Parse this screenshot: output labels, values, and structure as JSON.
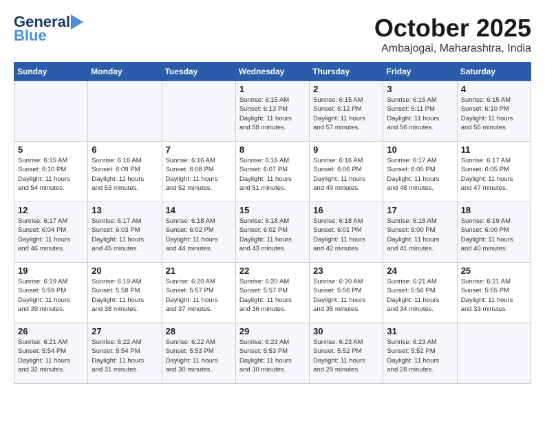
{
  "header": {
    "logo_general": "General",
    "logo_blue": "Blue",
    "month": "October 2025",
    "location": "Ambajogai, Maharashtra, India"
  },
  "days_of_week": [
    "Sunday",
    "Monday",
    "Tuesday",
    "Wednesday",
    "Thursday",
    "Friday",
    "Saturday"
  ],
  "weeks": [
    [
      {
        "day": "",
        "info": ""
      },
      {
        "day": "",
        "info": ""
      },
      {
        "day": "",
        "info": ""
      },
      {
        "day": "1",
        "info": "Sunrise: 6:15 AM\nSunset: 6:13 PM\nDaylight: 11 hours\nand 58 minutes."
      },
      {
        "day": "2",
        "info": "Sunrise: 6:15 AM\nSunset: 6:12 PM\nDaylight: 11 hours\nand 57 minutes."
      },
      {
        "day": "3",
        "info": "Sunrise: 6:15 AM\nSunset: 6:11 PM\nDaylight: 11 hours\nand 56 minutes."
      },
      {
        "day": "4",
        "info": "Sunrise: 6:15 AM\nSunset: 6:10 PM\nDaylight: 11 hours\nand 55 minutes."
      }
    ],
    [
      {
        "day": "5",
        "info": "Sunrise: 6:15 AM\nSunset: 6:10 PM\nDaylight: 11 hours\nand 54 minutes."
      },
      {
        "day": "6",
        "info": "Sunrise: 6:16 AM\nSunset: 6:09 PM\nDaylight: 11 hours\nand 53 minutes."
      },
      {
        "day": "7",
        "info": "Sunrise: 6:16 AM\nSunset: 6:08 PM\nDaylight: 11 hours\nand 52 minutes."
      },
      {
        "day": "8",
        "info": "Sunrise: 6:16 AM\nSunset: 6:07 PM\nDaylight: 11 hours\nand 51 minutes."
      },
      {
        "day": "9",
        "info": "Sunrise: 6:16 AM\nSunset: 6:06 PM\nDaylight: 11 hours\nand 49 minutes."
      },
      {
        "day": "10",
        "info": "Sunrise: 6:17 AM\nSunset: 6:05 PM\nDaylight: 11 hours\nand 48 minutes."
      },
      {
        "day": "11",
        "info": "Sunrise: 6:17 AM\nSunset: 6:05 PM\nDaylight: 11 hours\nand 47 minutes."
      }
    ],
    [
      {
        "day": "12",
        "info": "Sunrise: 6:17 AM\nSunset: 6:04 PM\nDaylight: 11 hours\nand 46 minutes."
      },
      {
        "day": "13",
        "info": "Sunrise: 6:17 AM\nSunset: 6:03 PM\nDaylight: 11 hours\nand 45 minutes."
      },
      {
        "day": "14",
        "info": "Sunrise: 6:18 AM\nSunset: 6:02 PM\nDaylight: 11 hours\nand 44 minutes."
      },
      {
        "day": "15",
        "info": "Sunrise: 6:18 AM\nSunset: 6:02 PM\nDaylight: 11 hours\nand 43 minutes."
      },
      {
        "day": "16",
        "info": "Sunrise: 6:18 AM\nSunset: 6:01 PM\nDaylight: 11 hours\nand 42 minutes."
      },
      {
        "day": "17",
        "info": "Sunrise: 6:18 AM\nSunset: 6:00 PM\nDaylight: 11 hours\nand 41 minutes."
      },
      {
        "day": "18",
        "info": "Sunrise: 6:19 AM\nSunset: 6:00 PM\nDaylight: 11 hours\nand 40 minutes."
      }
    ],
    [
      {
        "day": "19",
        "info": "Sunrise: 6:19 AM\nSunset: 5:59 PM\nDaylight: 11 hours\nand 39 minutes."
      },
      {
        "day": "20",
        "info": "Sunrise: 6:19 AM\nSunset: 5:58 PM\nDaylight: 11 hours\nand 38 minutes."
      },
      {
        "day": "21",
        "info": "Sunrise: 6:20 AM\nSunset: 5:57 PM\nDaylight: 11 hours\nand 37 minutes."
      },
      {
        "day": "22",
        "info": "Sunrise: 6:20 AM\nSunset: 5:57 PM\nDaylight: 11 hours\nand 36 minutes."
      },
      {
        "day": "23",
        "info": "Sunrise: 6:20 AM\nSunset: 5:56 PM\nDaylight: 11 hours\nand 35 minutes."
      },
      {
        "day": "24",
        "info": "Sunrise: 6:21 AM\nSunset: 5:56 PM\nDaylight: 11 hours\nand 34 minutes."
      },
      {
        "day": "25",
        "info": "Sunrise: 6:21 AM\nSunset: 5:55 PM\nDaylight: 11 hours\nand 33 minutes."
      }
    ],
    [
      {
        "day": "26",
        "info": "Sunrise: 6:21 AM\nSunset: 5:54 PM\nDaylight: 11 hours\nand 32 minutes."
      },
      {
        "day": "27",
        "info": "Sunrise: 6:22 AM\nSunset: 5:54 PM\nDaylight: 11 hours\nand 31 minutes."
      },
      {
        "day": "28",
        "info": "Sunrise: 6:22 AM\nSunset: 5:53 PM\nDaylight: 11 hours\nand 30 minutes."
      },
      {
        "day": "29",
        "info": "Sunrise: 6:23 AM\nSunset: 5:53 PM\nDaylight: 11 hours\nand 30 minutes."
      },
      {
        "day": "30",
        "info": "Sunrise: 6:23 AM\nSunset: 5:52 PM\nDaylight: 11 hours\nand 29 minutes."
      },
      {
        "day": "31",
        "info": "Sunrise: 6:23 AM\nSunset: 5:52 PM\nDaylight: 11 hours\nand 28 minutes."
      },
      {
        "day": "",
        "info": ""
      }
    ]
  ]
}
